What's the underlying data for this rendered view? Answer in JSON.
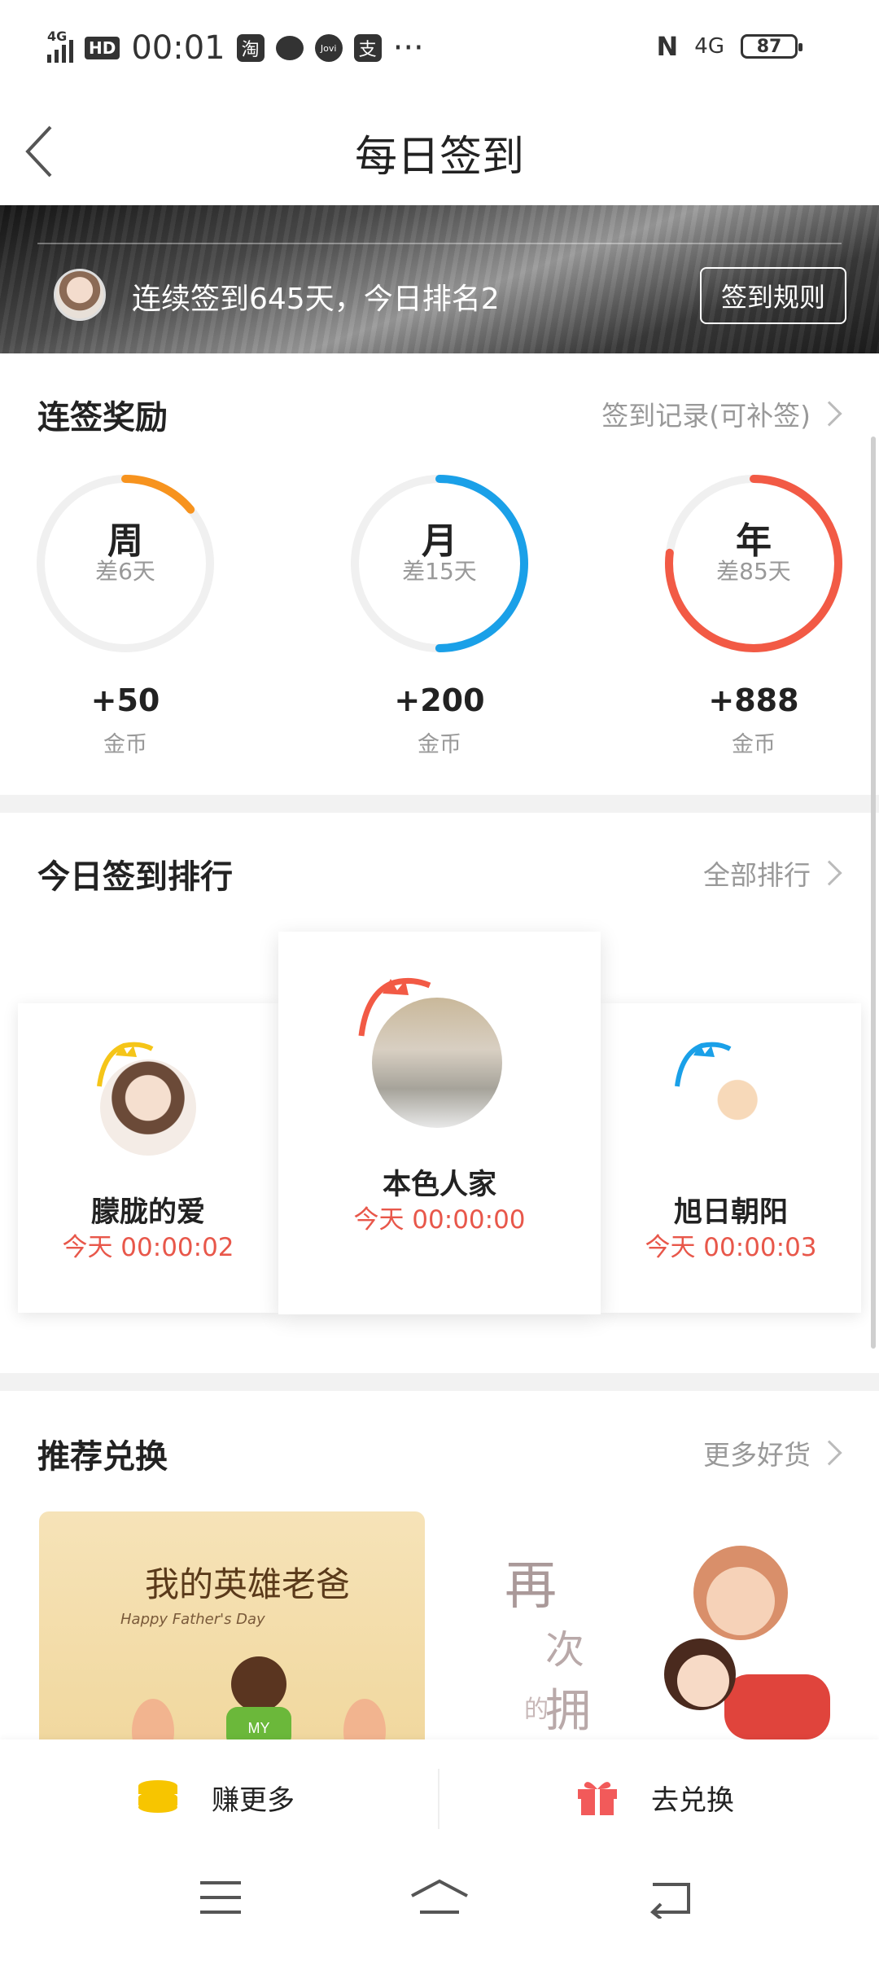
{
  "status_bar": {
    "network": "4G",
    "hd": "HD",
    "time": "00:01",
    "app_icons": [
      "taobao-icon",
      "message-icon",
      "jovi-icon",
      "alipay-icon"
    ],
    "taobao_glyph": "淘",
    "jovi_glyph": "Jovi",
    "alipay_glyph": "支",
    "more": "···",
    "nfc": "N",
    "net_right": "4G",
    "battery": "87"
  },
  "header": {
    "title": "每日签到"
  },
  "banner": {
    "streak_text": "连续签到645天，今日排名2",
    "rule_button": "签到规则"
  },
  "streak_rewards": {
    "title": "连签奖励",
    "link": "签到记录(可补签)",
    "items": [
      {
        "label": "周",
        "remain": "差6天",
        "reward": "+50",
        "unit": "金币",
        "progress": 0.14,
        "color": "#f7931e"
      },
      {
        "label": "月",
        "remain": "差15天",
        "reward": "+200",
        "unit": "金币",
        "progress": 0.5,
        "color": "#1aa0e8"
      },
      {
        "label": "年",
        "remain": "差85天",
        "reward": "+888",
        "unit": "金币",
        "progress": 0.77,
        "color": "#f25a45"
      }
    ]
  },
  "ranking": {
    "title": "今日签到排行",
    "link": "全部排行",
    "entries": [
      {
        "rank": 2,
        "name": "朦胧的爱",
        "time": "今天 00:00:02",
        "crown_color": "#f5c518"
      },
      {
        "rank": 1,
        "name": "本色人家",
        "time": "今天 00:00:00",
        "crown_color": "#f25a45"
      },
      {
        "rank": 3,
        "name": "旭日朝阳",
        "time": "今天 00:00:03",
        "crown_color": "#1aa0e8"
      }
    ]
  },
  "recommend": {
    "title": "推荐兑换",
    "link": "更多好货",
    "item1_text": "我的英雄老爸",
    "item1_sub": "Happy Father's Day",
    "item1_badge": "MY",
    "item2_text1": "再",
    "item2_text2": "次",
    "item2_text3": "的",
    "item2_text4": "拥"
  },
  "actions": {
    "earn_more": "赚更多",
    "redeem": "去兑换"
  },
  "colors": {
    "accent_red": "#e8574a",
    "text_gray": "#999999"
  }
}
